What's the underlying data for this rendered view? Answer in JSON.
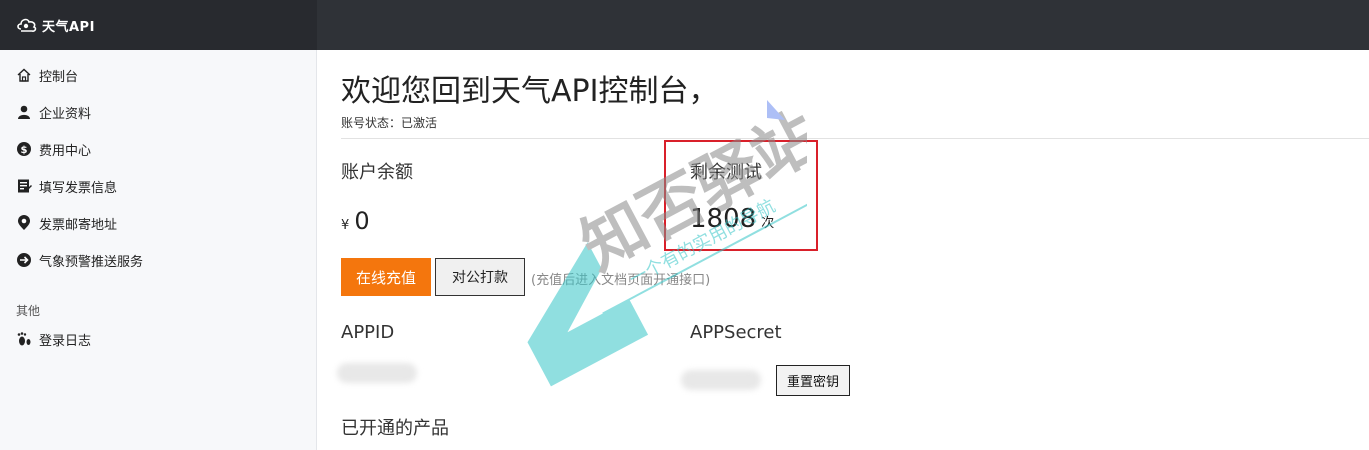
{
  "brand": {
    "name": "天气API"
  },
  "sidebar": {
    "items": [
      {
        "label": "控制台",
        "icon": "home-icon"
      },
      {
        "label": "企业资料",
        "icon": "user-icon"
      },
      {
        "label": "费用中心",
        "icon": "dollar-icon"
      },
      {
        "label": "填写发票信息",
        "icon": "invoice-icon"
      },
      {
        "label": "发票邮寄地址",
        "icon": "location-icon"
      },
      {
        "label": "气象预警推送服务",
        "icon": "arrow-right-circle-icon"
      }
    ],
    "group_label": "其他",
    "group_items": [
      {
        "label": "登录日志",
        "icon": "footprint-icon"
      }
    ]
  },
  "main": {
    "welcome": "欢迎您回到天气API控制台，",
    "status": "账号状态：已激活",
    "balance_label": "账户余额",
    "balance_currency": "¥",
    "balance_value": "0",
    "remain_label": "剩余测试",
    "remain_value": "1808",
    "remain_unit": "次",
    "recharge_button": "在线充值",
    "transfer_button": "对公打款",
    "recharge_note": "(充值后进入文档页面开通接口)",
    "appid_label": "APPID",
    "appsecret_label": "APPSecret",
    "reset_button": "重置密钥",
    "products_label": "已开通的产品"
  },
  "watermark": {
    "text": "知否驿站",
    "subtext": "一个有的实用的导航"
  },
  "colors": {
    "accent": "#f4760d",
    "topbar": "#2f3237",
    "highlight": "#d9202a",
    "watermark": "#37c6c8"
  }
}
